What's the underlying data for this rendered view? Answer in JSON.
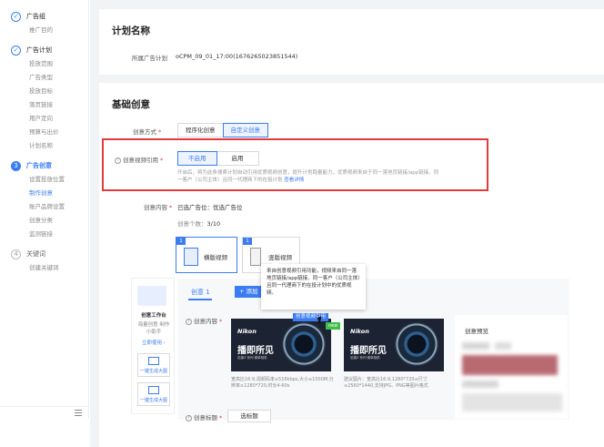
{
  "sidebar": {
    "steps": [
      {
        "label": "广告组",
        "state": "done",
        "marker": "✓",
        "subs": [
          "推广目的"
        ]
      },
      {
        "label": "广告计划",
        "state": "done",
        "marker": "✓",
        "subs": [
          "投放范围",
          "广告类型",
          "投放目标",
          "落页链接",
          "用户定向",
          "预算与出价",
          "计划名称"
        ]
      },
      {
        "label": "广告创意",
        "state": "active",
        "marker": "3",
        "subs": [
          "设置投放位置",
          "制作创意",
          "账户品牌设置",
          "创意分类",
          "监测链接"
        ]
      },
      {
        "label": "关键词",
        "state": "todo",
        "marker": "4",
        "subs": [
          "创建关键词"
        ]
      }
    ],
    "active_sub": "制作创意"
  },
  "plan": {
    "title": "计划名称",
    "belong_label": "所属广告计划",
    "belong_value": "oCPM_09_01_17:00(1676265023851544)"
  },
  "basic": {
    "title": "基础创意",
    "method_label": "创意方式",
    "method_options": [
      "程序化创意",
      "自定义创意"
    ],
    "ref_label": "创意视频引用",
    "ref_options": [
      "不启用",
      "启用"
    ],
    "ref_hint_1": "开启后，将为此条搜索计划自动引用优质视频创意，提升计划跑量能力，优质视频来自于同一落地页链接/app链接、同",
    "ref_hint_2": "一客户（公司主体）且同一代理商下的在投计划",
    "ref_hint_link": "查看详情",
    "content_label": "创意内容",
    "content_selected_prefix": "已选广告位：",
    "content_selected_value": "优选广告位",
    "creative_count_label": "创意个数：",
    "creative_count_value": "3/10",
    "layout_tabs": [
      {
        "index": "1",
        "name": "横版视频"
      },
      {
        "index": "1",
        "name": "竖版视频"
      }
    ],
    "tooltip": "来自创意视频引用功能，视频来自同一落地页链接/app链接、同一客户（公司主体）且同一代理商下的在投计划中的优质视频。",
    "inner_tab": "创意 1",
    "add_button": "+ 添加",
    "workbench": {
      "title": "创意工作台",
      "desc": "海量创意 制作小助手",
      "use_link": "立即使用 ›",
      "btn1": "一键生成大图",
      "btn2": "一键生成大图"
    },
    "creative_content_label": "创意内容",
    "ref_badge": "创意视频引用",
    "new_badge": "new",
    "video_cards": [
      {
        "brand": "Nikon",
        "slogan": "播即所见",
        "small": "尼康Z 系列 微单相机",
        "caption": "宽高比16:9,视频码率≥516kbps,大小≤1000M,分辨率≥1280*720,时长4-60s"
      },
      {
        "brand": "Nikon",
        "slogan": "播即所见",
        "small": "尼康Z 系列 微单相机",
        "caption": "建议图片：宽高比16:9,1280*720≤尺寸≤2560*1440,支持JPG、PNG等图片格式"
      }
    ],
    "preview_title": "创意预览",
    "title_label": "创意标题",
    "select_title_btn": "选标题"
  },
  "colors": {
    "accent": "#3b7cf3",
    "highlight": "#e33b3b",
    "new": "#3fbe4a"
  }
}
